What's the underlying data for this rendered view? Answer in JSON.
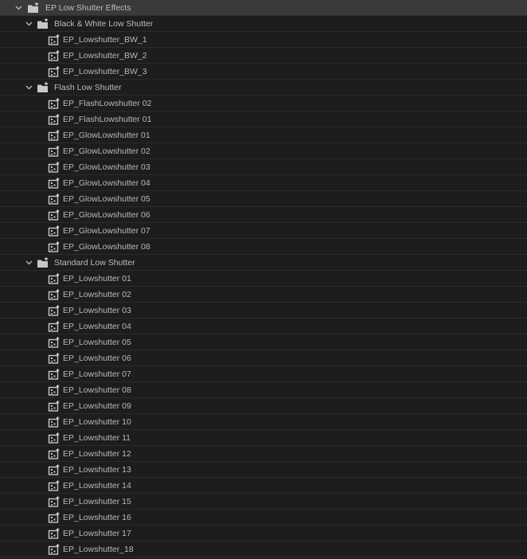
{
  "tree": [
    {
      "level": 0,
      "type": "folder",
      "expanded": true,
      "label": "EP Low Shutter Effects",
      "icon": "folder-star-icon"
    },
    {
      "level": 1,
      "type": "folder",
      "expanded": true,
      "label": "Black & White Low Shutter",
      "icon": "folder-star-icon"
    },
    {
      "level": 2,
      "type": "preset",
      "label": "EP_Lowshutter_BW_1",
      "icon": "preset-icon"
    },
    {
      "level": 2,
      "type": "preset",
      "label": "EP_Lowshutter_BW_2",
      "icon": "preset-icon"
    },
    {
      "level": 2,
      "type": "preset",
      "label": "EP_Lowshutter_BW_3",
      "icon": "preset-icon"
    },
    {
      "level": 1,
      "type": "folder",
      "expanded": true,
      "label": "Flash Low Shutter",
      "icon": "folder-star-icon"
    },
    {
      "level": 2,
      "type": "preset",
      "label": "EP_FlashLowshutter 02",
      "icon": "preset-icon"
    },
    {
      "level": 2,
      "type": "preset",
      "label": "EP_FlashLowshutter 01",
      "icon": "preset-icon"
    },
    {
      "level": 2,
      "type": "preset",
      "label": "EP_GlowLowshutter 01",
      "icon": "preset-icon"
    },
    {
      "level": 2,
      "type": "preset",
      "label": "EP_GlowLowshutter 02",
      "icon": "preset-icon"
    },
    {
      "level": 2,
      "type": "preset",
      "label": "EP_GlowLowshutter 03",
      "icon": "preset-icon"
    },
    {
      "level": 2,
      "type": "preset",
      "label": "EP_GlowLowshutter 04",
      "icon": "preset-icon"
    },
    {
      "level": 2,
      "type": "preset",
      "label": "EP_GlowLowshutter 05",
      "icon": "preset-icon"
    },
    {
      "level": 2,
      "type": "preset",
      "label": "EP_GlowLowshutter 06",
      "icon": "preset-icon"
    },
    {
      "level": 2,
      "type": "preset",
      "label": "EP_GlowLowshutter 07",
      "icon": "preset-icon"
    },
    {
      "level": 2,
      "type": "preset",
      "label": "EP_GlowLowshutter 08",
      "icon": "preset-icon"
    },
    {
      "level": 1,
      "type": "folder",
      "expanded": true,
      "label": "Standard Low Shutter",
      "icon": "folder-star-icon"
    },
    {
      "level": 2,
      "type": "preset",
      "label": "EP_Lowshutter 01",
      "icon": "preset-icon"
    },
    {
      "level": 2,
      "type": "preset",
      "label": "EP_Lowshutter 02",
      "icon": "preset-icon"
    },
    {
      "level": 2,
      "type": "preset",
      "label": "EP_Lowshutter 03",
      "icon": "preset-icon"
    },
    {
      "level": 2,
      "type": "preset",
      "label": "EP_Lowshutter 04",
      "icon": "preset-icon"
    },
    {
      "level": 2,
      "type": "preset",
      "label": "EP_Lowshutter 05",
      "icon": "preset-icon"
    },
    {
      "level": 2,
      "type": "preset",
      "label": "EP_Lowshutter 06",
      "icon": "preset-icon"
    },
    {
      "level": 2,
      "type": "preset",
      "label": "EP_Lowshutter 07",
      "icon": "preset-icon"
    },
    {
      "level": 2,
      "type": "preset",
      "label": "EP_Lowshutter 08",
      "icon": "preset-icon"
    },
    {
      "level": 2,
      "type": "preset",
      "label": "EP_Lowshutter 09",
      "icon": "preset-icon"
    },
    {
      "level": 2,
      "type": "preset",
      "label": "EP_Lowshutter 10",
      "icon": "preset-icon"
    },
    {
      "level": 2,
      "type": "preset",
      "label": "EP_Lowshutter 11",
      "icon": "preset-icon"
    },
    {
      "level": 2,
      "type": "preset",
      "label": "EP_Lowshutter 12",
      "icon": "preset-icon"
    },
    {
      "level": 2,
      "type": "preset",
      "label": "EP_Lowshutter 13",
      "icon": "preset-icon"
    },
    {
      "level": 2,
      "type": "preset",
      "label": "EP_Lowshutter 14",
      "icon": "preset-icon"
    },
    {
      "level": 2,
      "type": "preset",
      "label": "EP_Lowshutter 15",
      "icon": "preset-icon"
    },
    {
      "level": 2,
      "type": "preset",
      "label": "EP_Lowshutter 16",
      "icon": "preset-icon"
    },
    {
      "level": 2,
      "type": "preset",
      "label": "EP_Lowshutter 17",
      "icon": "preset-icon"
    },
    {
      "level": 2,
      "type": "preset",
      "label": "EP_Lowshutter_18",
      "icon": "preset-icon"
    }
  ],
  "colors": {
    "background": "#1d1d1d",
    "root_row": "#3a3a3a",
    "divider": "#2b2b2b",
    "text": "#b9b9b9",
    "icon": "#c8c8c8"
  }
}
